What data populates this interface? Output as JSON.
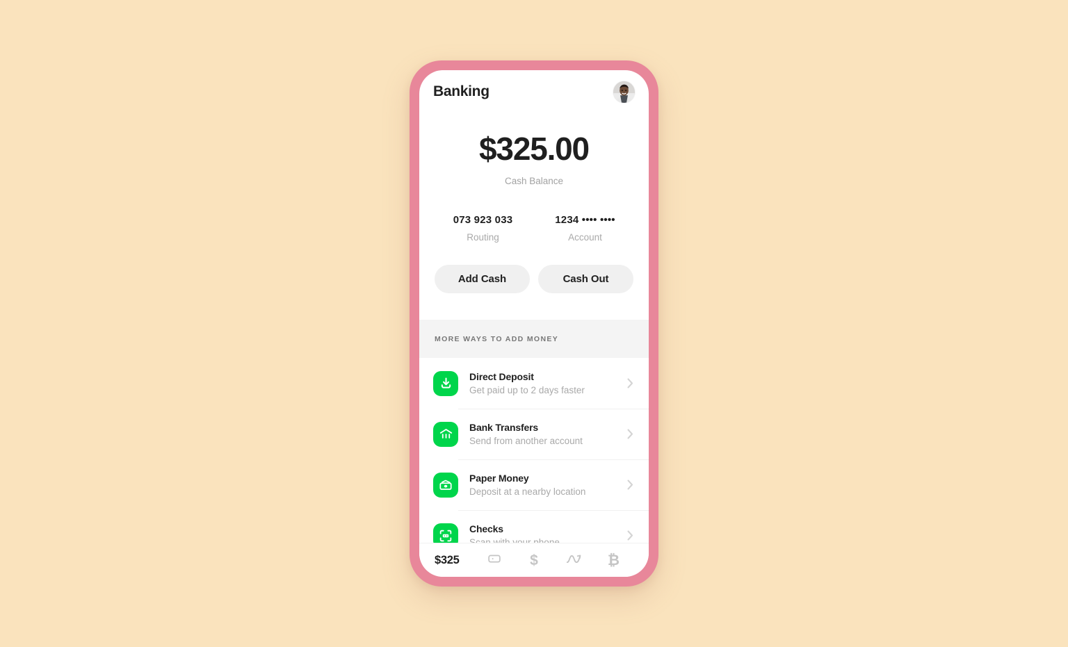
{
  "theme": {
    "page_background": "#FAE3BD",
    "phone_frame_color": "#E8879A",
    "screen_background": "#FFFFFF",
    "accent_green": "#00D54B",
    "button_gray": "#F0F0F0",
    "section_band_gray": "#F4F4F4",
    "muted_text": "#A9A9A9",
    "primary_text": "#1F1F1F"
  },
  "header": {
    "title": "Banking",
    "avatar_icon": "user-photo-avatar"
  },
  "balance": {
    "amount": "$325.00",
    "caption": "Cash Balance"
  },
  "account_details": [
    {
      "value": "073 923 033",
      "label": "Routing",
      "name": "routing"
    },
    {
      "value": "1234 •••• ••••",
      "label": "Account",
      "name": "account"
    }
  ],
  "actions": [
    {
      "label": "Add Cash",
      "name": "add-cash"
    },
    {
      "label": "Cash Out",
      "name": "cash-out"
    }
  ],
  "more_ways": {
    "section_title": "MORE WAYS TO ADD MONEY",
    "items": [
      {
        "title": "Direct Deposit",
        "subtitle": "Get paid up to 2 days faster",
        "icon": "download-tray-icon",
        "chevron": "chevron-right-icon"
      },
      {
        "title": "Bank Transfers",
        "subtitle": "Send from another account",
        "icon": "bank-building-icon",
        "chevron": "chevron-right-icon"
      },
      {
        "title": "Paper Money",
        "subtitle": "Deposit at a nearby location",
        "icon": "banknote-stack-icon",
        "chevron": "chevron-right-icon"
      },
      {
        "title": "Checks",
        "subtitle": "Scan with your phone",
        "icon": "check-scan-icon",
        "chevron": "chevron-right-icon"
      }
    ]
  },
  "tab_bar": {
    "balance_label": "$325",
    "tabs": [
      {
        "name": "balance",
        "label": "$325",
        "icon": "balance-amount"
      },
      {
        "name": "card",
        "label": "",
        "icon": "card-icon"
      },
      {
        "name": "payments",
        "label": "$",
        "icon": "dollar-sign-icon"
      },
      {
        "name": "investing",
        "label": "",
        "icon": "stock-trend-icon"
      },
      {
        "name": "bitcoin",
        "label": "₿",
        "icon": "bitcoin-icon"
      }
    ]
  }
}
